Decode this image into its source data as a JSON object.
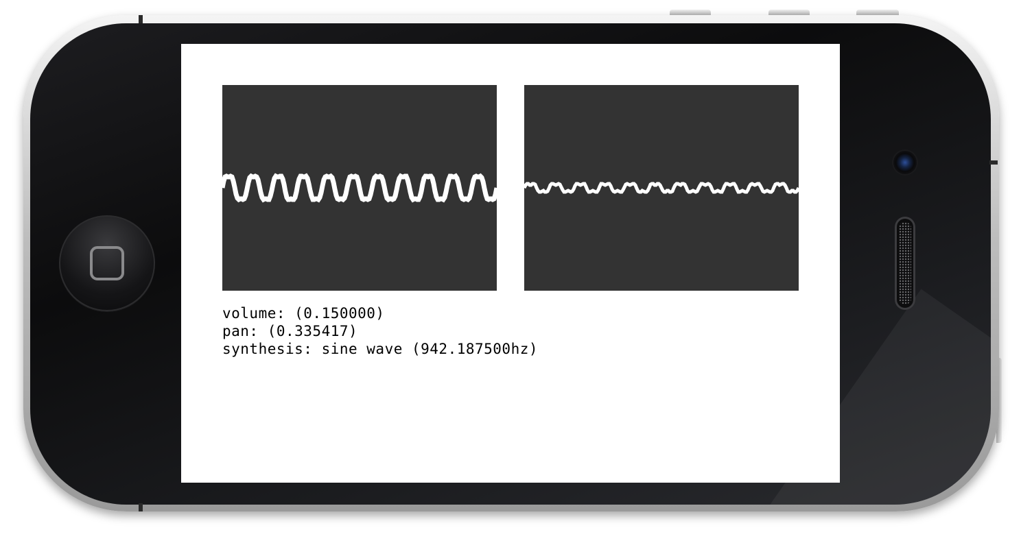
{
  "readouts": {
    "volume": "volume: (0.150000)",
    "pan": "pan: (0.335417)",
    "synthesis": "synthesis: sine wave (942.187500hz)"
  },
  "waveform_left": {
    "cycles": 11,
    "amplitude": 0.065,
    "ripple": 0.012
  },
  "waveform_right": {
    "cycles": 11,
    "amplitude": 0.022,
    "ripple": 0.008
  },
  "colors": {
    "scope_background": "#333333",
    "waveform": "#ffffff",
    "screen_background": "#ffffff",
    "text": "#000000"
  }
}
